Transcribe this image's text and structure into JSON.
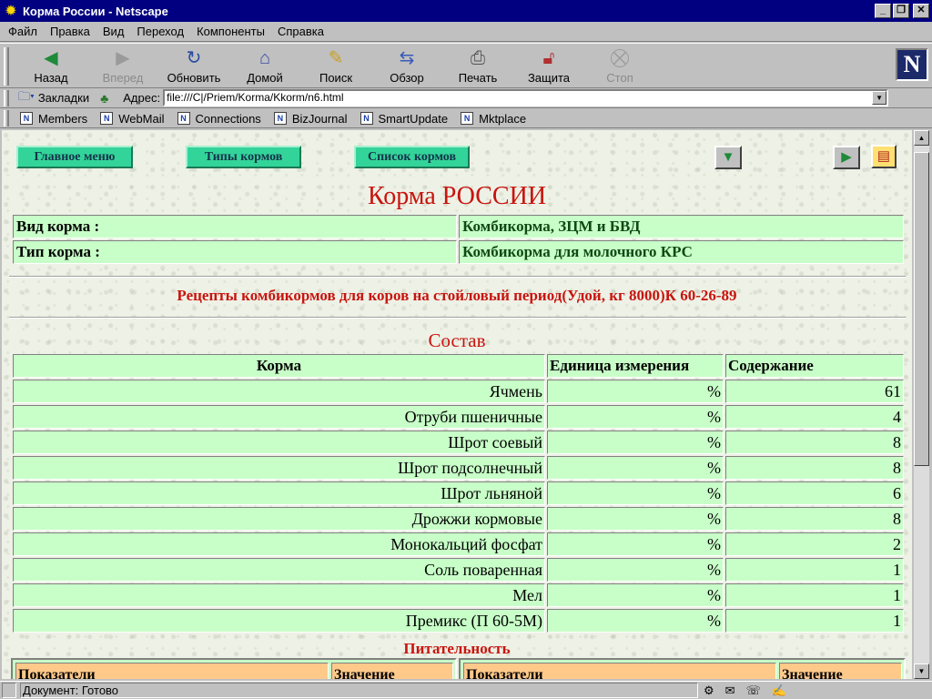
{
  "window": {
    "title": "Корма России - Netscape"
  },
  "menu": [
    "Файл",
    "Правка",
    "Вид",
    "Переход",
    "Компоненты",
    "Справка"
  ],
  "toolbar": {
    "back": "Назад",
    "forward": "Вперед",
    "reload": "Обновить",
    "home": "Домой",
    "search": "Поиск",
    "guide": "Обзор",
    "print": "Печать",
    "security": "Защита",
    "stop": "Стоп"
  },
  "location": {
    "bookmarks_label": "Закладки",
    "address_label": "Адрес:",
    "url": "file:///C|/Priem/Korma/Kkorm/n6.html"
  },
  "personal": [
    "Members",
    "WebMail",
    "Connections",
    "BizJournal",
    "SmartUpdate",
    "Mktplace"
  ],
  "page": {
    "nav": {
      "main_menu": "Главное меню",
      "feed_types": "Типы кормов",
      "feed_list": "Список кормов"
    },
    "title": "Корма РОССИИ",
    "info": {
      "kind_label": "Вид корма :",
      "kind_value": "Комбикорма, ЗЦМ и БВД",
      "type_label": "Тип корма :",
      "type_value": "Комбикорма для молочного КРС"
    },
    "recipe_title": "Рецепты комбикормов для коров на стойловый период(Удой, кг 8000)К 60-26-89",
    "composition_title": "Состав",
    "composition_headers": {
      "feed": "Корма",
      "unit": "Единица измерения",
      "content": "Содержание"
    },
    "composition": [
      {
        "name": "Ячмень",
        "unit": "%",
        "value": "61"
      },
      {
        "name": "Отруби пшеничные",
        "unit": "%",
        "value": "4"
      },
      {
        "name": "Шрот соевый",
        "unit": "%",
        "value": "8"
      },
      {
        "name": "Шрот подсолнечный",
        "unit": "%",
        "value": "8"
      },
      {
        "name": "Шрот льняной",
        "unit": "%",
        "value": "6"
      },
      {
        "name": "Дрожжи кормовые",
        "unit": "%",
        "value": "8"
      },
      {
        "name": "Монокальций фосфат",
        "unit": "%",
        "value": "2"
      },
      {
        "name": "Соль поваренная",
        "unit": "%",
        "value": "1"
      },
      {
        "name": "Мел",
        "unit": "%",
        "value": "1"
      },
      {
        "name": "Премикс (П 60-5М)",
        "unit": "%",
        "value": "1"
      }
    ],
    "nutrition_title": "Питательность",
    "nutrition_headers": {
      "indicator": "Показатели",
      "value": "Значение"
    }
  },
  "status": {
    "text": "Документ: Готово"
  }
}
